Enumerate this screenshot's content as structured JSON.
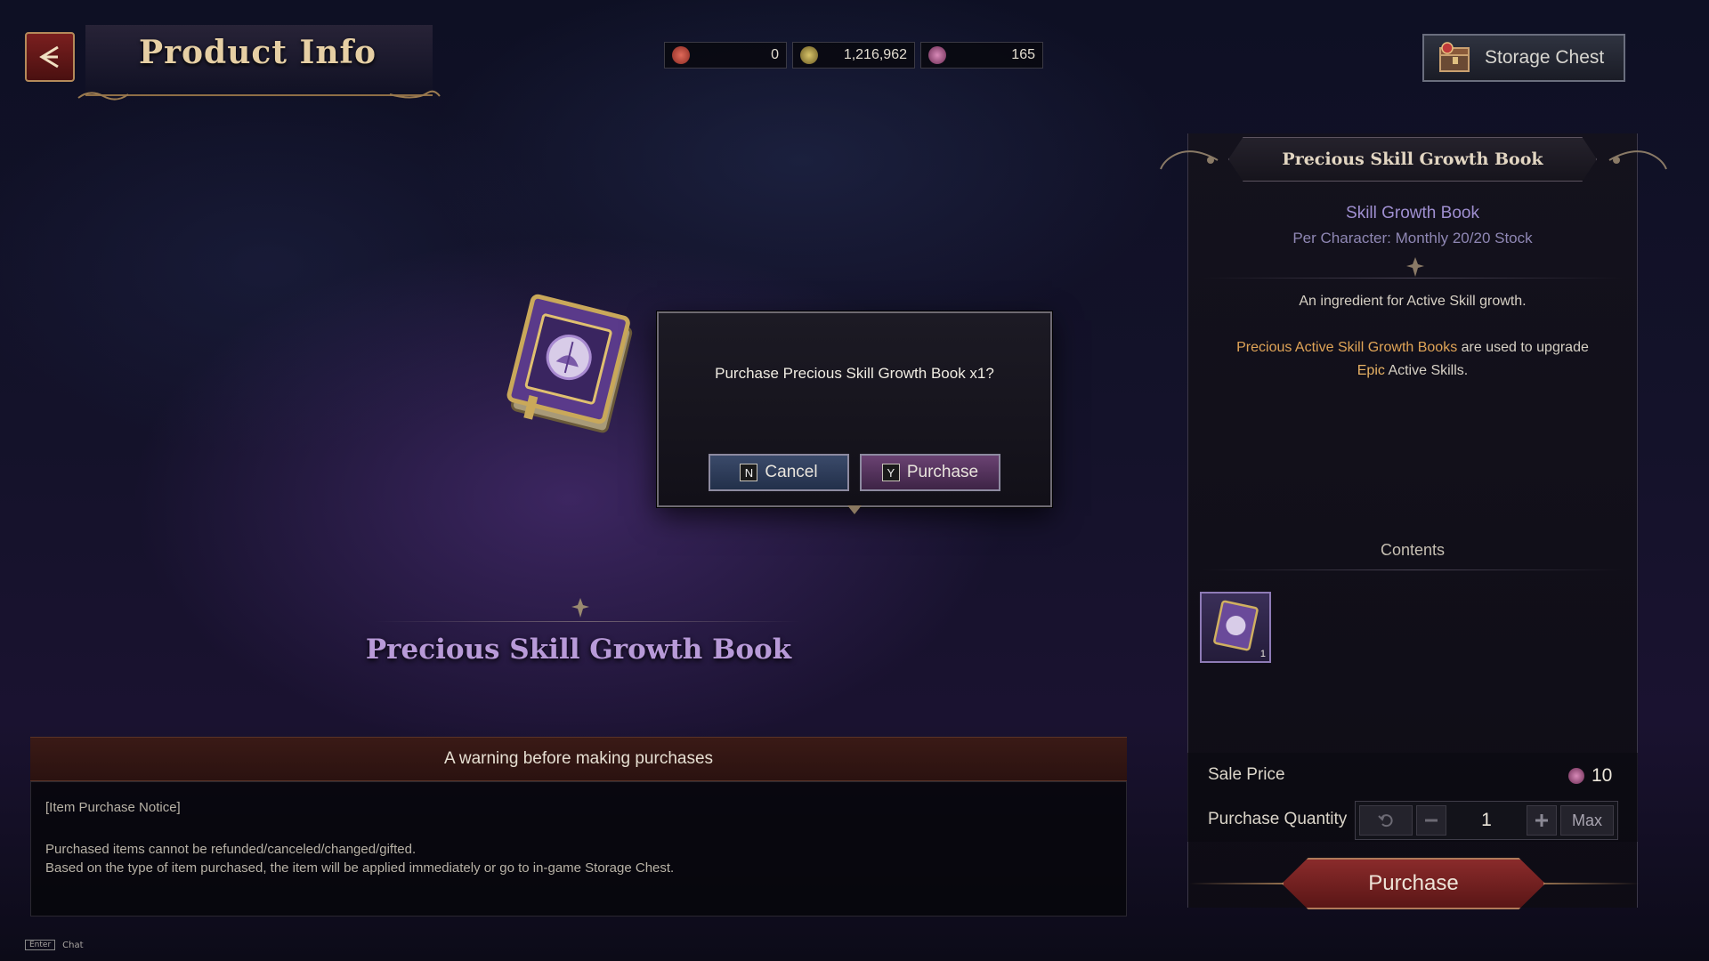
{
  "header": {
    "title": "Product Info",
    "storage_label": "Storage Chest"
  },
  "currencies": [
    {
      "name": "ticket",
      "value": "0",
      "color": "#c0433a"
    },
    {
      "name": "gold",
      "value": "1,216,962",
      "color": "#b5a14e"
    },
    {
      "name": "gem",
      "value": "165",
      "color": "#b05a8e"
    }
  ],
  "dialog": {
    "message": "Purchase Precious Skill Growth Book x1?",
    "cancel_key": "N",
    "cancel_label": "Cancel",
    "confirm_key": "Y",
    "confirm_label": "Purchase"
  },
  "center": {
    "item_name": "Precious Skill Growth Book"
  },
  "warning": {
    "header": "A warning before making purchases",
    "notice_title": "[Item Purchase Notice]",
    "line1": "Purchased items cannot be refunded/canceled/changed/gifted.",
    "line2": "Based on the type of item purchased, the item will be applied immediately or go to in-game Storage Chest."
  },
  "chat": {
    "key": "Enter",
    "label": "Chat"
  },
  "details": {
    "title": "Precious Skill Growth Book",
    "category": "Skill Growth Book",
    "stock": "Per Character:  Monthly 20/20 Stock",
    "desc1": "An ingredient for Active Skill growth.",
    "desc2_highlight": "Precious Active Skill Growth Books",
    "desc2_mid": " are used to upgrade ",
    "desc2_highlight2": "Epic",
    "desc2_end": " Active Skills.",
    "contents_label": "Contents",
    "content_qty": "1",
    "sale_price_label": "Sale Price",
    "sale_price": "10",
    "qty_label": "Purchase Quantity",
    "qty_value": "1",
    "max_label": "Max",
    "purchase_label": "Purchase"
  },
  "colors": {
    "accent_purple": "#b89ad8",
    "purchase_red": "#8a2b2b",
    "highlight_orange": "#e0a457"
  },
  "icons": {
    "back": "back-arrow-icon",
    "storage": "chest-icon",
    "gem": "gem-icon"
  }
}
